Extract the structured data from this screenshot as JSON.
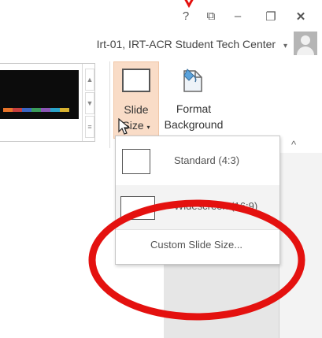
{
  "window": {
    "help_glyph": "?",
    "ribbon_options_glyph": "⧉",
    "minimize_glyph": "–",
    "restore_glyph": "❐",
    "close_glyph": "✕"
  },
  "account": {
    "name": "Irt-01, IRT-ACR Student Tech Center",
    "caret": "▾"
  },
  "ribbon": {
    "slide_size": {
      "line1": "Slide",
      "line2": "Size",
      "caret": "▾"
    },
    "format_background": {
      "line1": "Format",
      "line2": "Background"
    },
    "collapse_glyph": "^",
    "theme_colors": [
      "#e8742a",
      "#c63f3f",
      "#3b66c4",
      "#3b9c5b",
      "#8a56b5",
      "#2aa4c9",
      "#d8b230"
    ]
  },
  "slide_size_menu": {
    "items": [
      {
        "label": "Standard (4:3)",
        "selected": false
      },
      {
        "label": "Widescreen (16:9)",
        "selected": true
      }
    ],
    "custom_label": "Custom Slide Size..."
  },
  "annotations": {
    "highlight_color": "#e4110f"
  }
}
